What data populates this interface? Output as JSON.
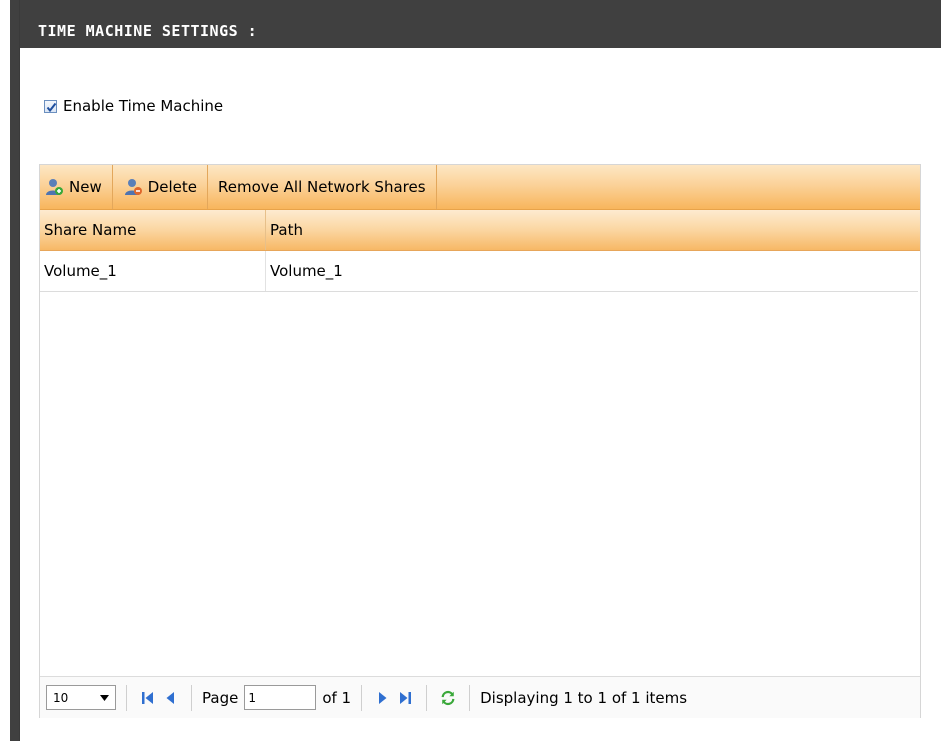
{
  "header": {
    "title": "TIME MACHINE SETTINGS :"
  },
  "enable": {
    "label": "Enable Time Machine",
    "checked": true
  },
  "toolbar": {
    "new_label": "New",
    "delete_label": "Delete",
    "remove_all_label": "Remove All Network Shares"
  },
  "table": {
    "columns": [
      "Share Name",
      "Path"
    ],
    "rows": [
      {
        "share_name": "Volume_1",
        "path": "Volume_1"
      }
    ]
  },
  "pager": {
    "page_size": "10",
    "page_label": "Page",
    "page_value": "1",
    "of_label": "of 1",
    "status": "Displaying 1 to 1 of 1 items"
  },
  "colors": {
    "header_bg": "#404040",
    "toolbar_orange": "#f8b55c"
  }
}
